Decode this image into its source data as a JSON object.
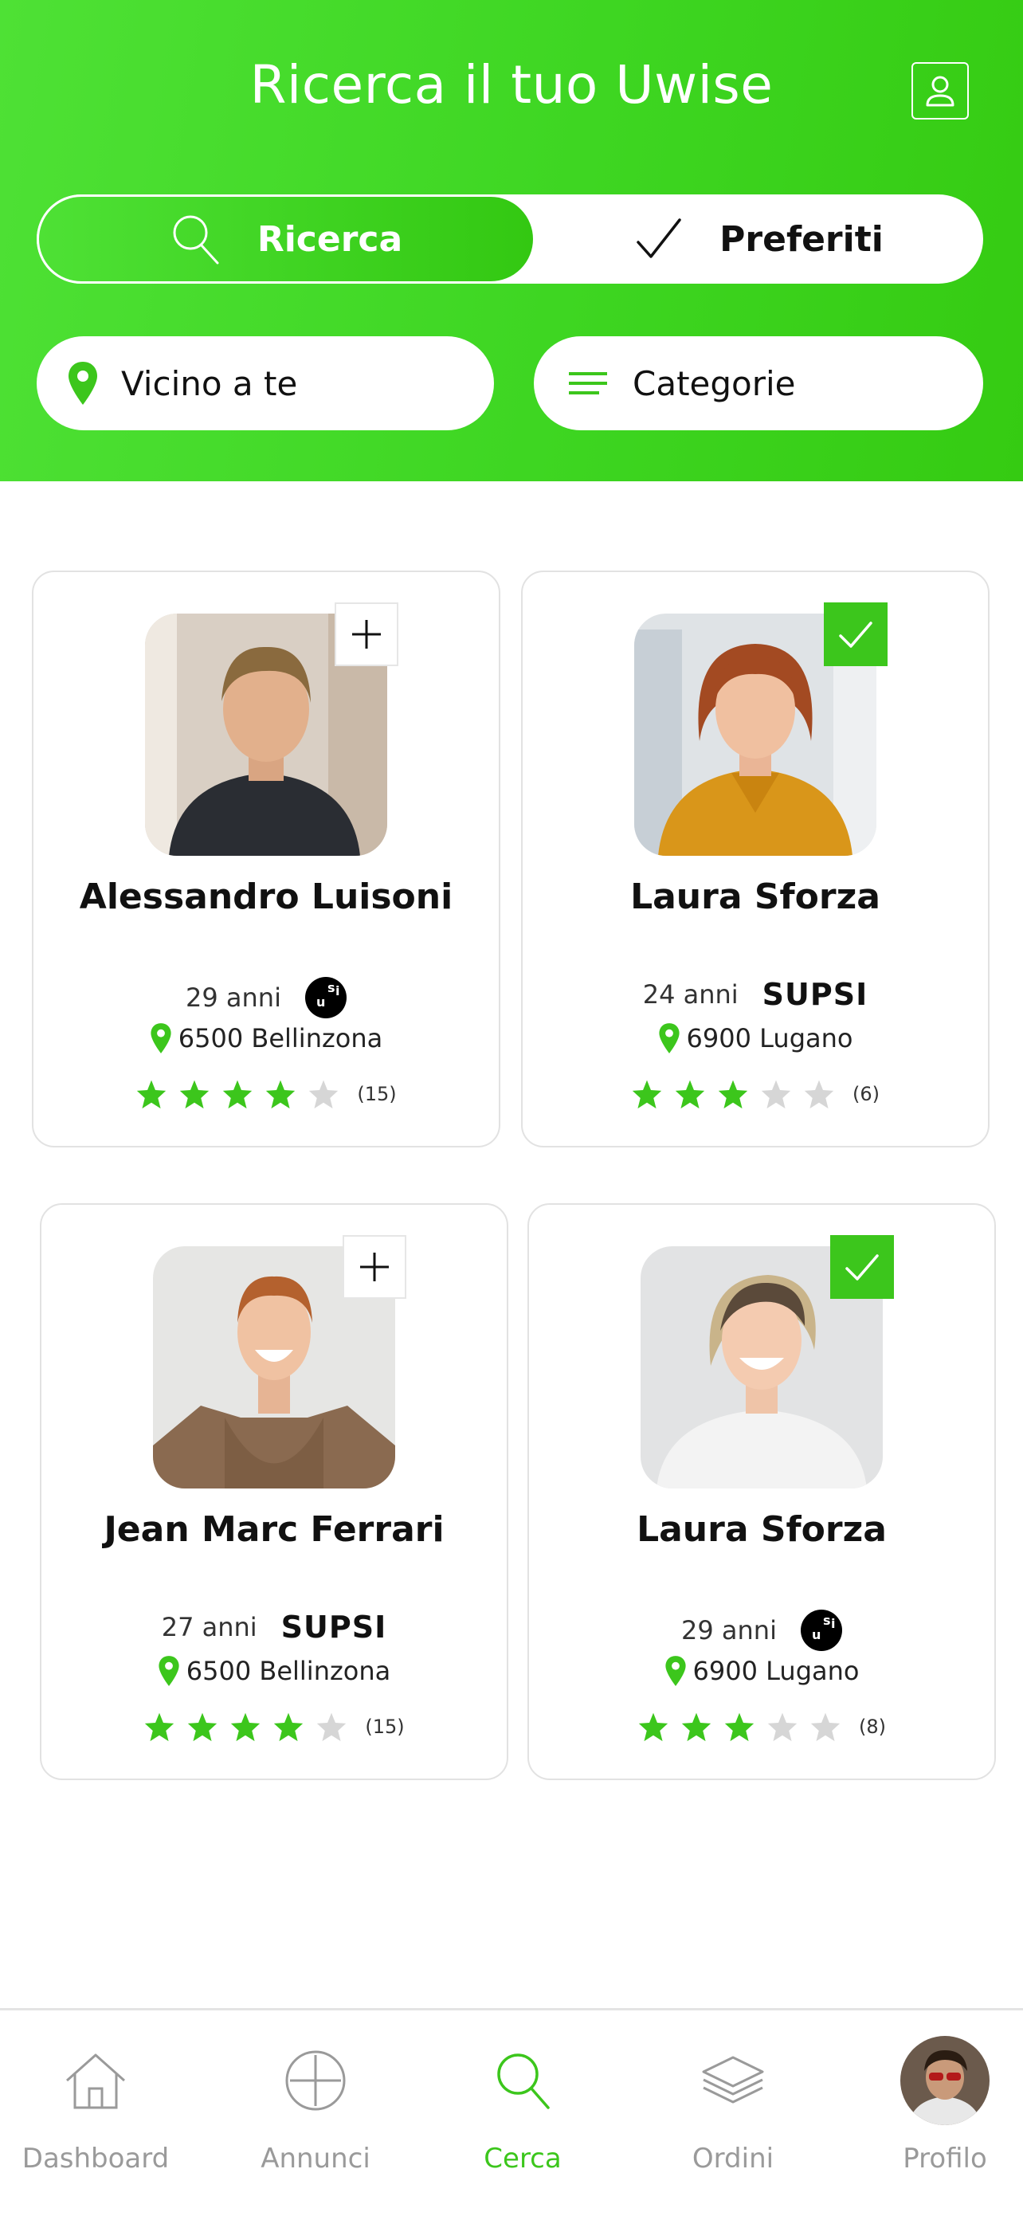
{
  "header": {
    "title": "Ricerca il tuo Uwise",
    "profile_icon": "user-icon"
  },
  "segmented": {
    "search_label": "Ricerca",
    "favorites_label": "Preferiti"
  },
  "filters": {
    "near_label": "Vicino a te",
    "categories_label": "Categorie"
  },
  "colors": {
    "accent": "#3cc61c",
    "header_gradient_start": "#4ee135",
    "header_gradient_end": "#35cb12",
    "star_empty": "#d6d6d6"
  },
  "profiles": [
    {
      "name": "Alessandro Luisoni",
      "age": "29 anni",
      "school": "USI",
      "location": "6500 Bellinzona",
      "rating": 4,
      "rating_count": "(15)",
      "favorite": false
    },
    {
      "name": "Laura Sforza",
      "age": "24 anni",
      "school": "SUPSI",
      "location": "6900 Lugano",
      "rating": 3,
      "rating_count": "(6)",
      "favorite": true
    },
    {
      "name": "Jean Marc Ferrari",
      "age": "27 anni",
      "school": "SUPSI",
      "location": "6500 Bellinzona",
      "rating": 4,
      "rating_count": "(15)",
      "favorite": false
    },
    {
      "name": "Laura Sforza",
      "age": "29 anni",
      "school": "USI",
      "location": "6900 Lugano",
      "rating": 3,
      "rating_count": "(8)",
      "favorite": true
    }
  ],
  "nav": {
    "items": [
      {
        "label": "Dashboard",
        "icon": "home-icon"
      },
      {
        "label": "Annunci",
        "icon": "plus-circle-icon"
      },
      {
        "label": "Cerca",
        "icon": "search-icon",
        "active": true
      },
      {
        "label": "Ordini",
        "icon": "layers-icon"
      },
      {
        "label": "Profilo",
        "icon": "avatar"
      }
    ]
  }
}
